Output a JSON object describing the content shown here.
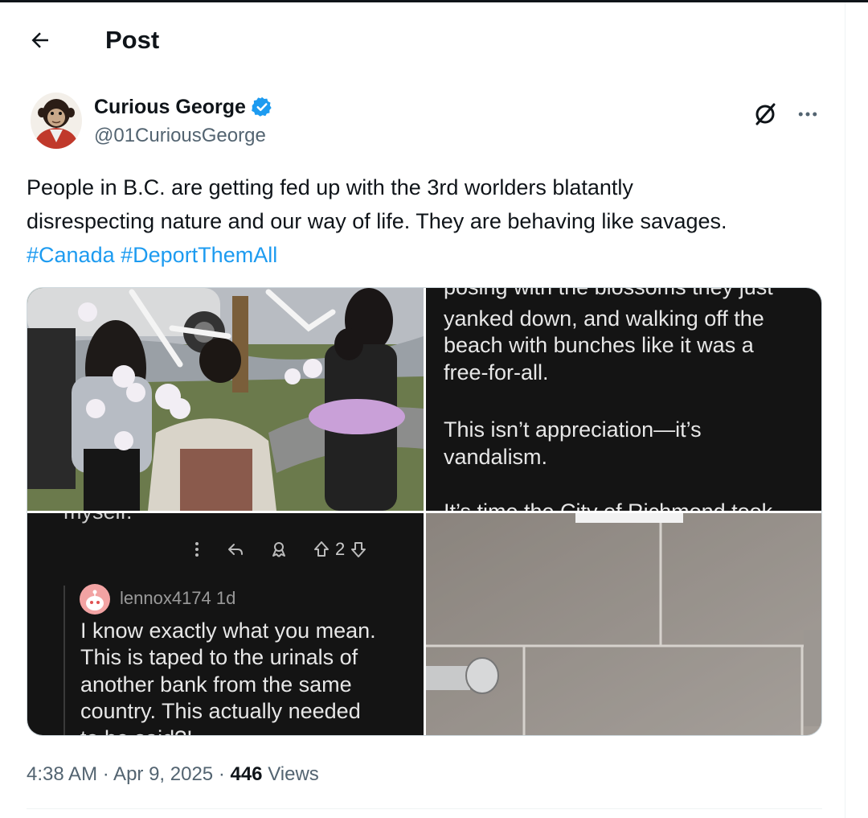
{
  "header": {
    "title": "Post"
  },
  "post": {
    "author": {
      "name": "Curious George",
      "handle": "@01CuriousGeorge"
    },
    "text_line_1": "People in B.C. are getting fed up with the 3rd worlders blatantly",
    "text_line_2": "disrespecting nature and our way of life.  They are behaving like savages.",
    "hashtags": [
      "#Canada",
      "#DeportThemAll"
    ],
    "timestamp": "4:38 AM · Apr 9, 2025",
    "separator": " · ",
    "views_count": "446",
    "views_label": " Views"
  },
  "media": {
    "tile_2": {
      "line_cut_top": "posing with the blossoms they just",
      "line_1": "yanked down, and walking off the",
      "line_2": "beach with bunches like it was a",
      "line_3": "free-for-all.",
      "line_4": "This isn’t appreciation—it’s",
      "line_5": "vandalism.",
      "line_cut_bottom": "It’s time the City of Richmond took"
    },
    "tile_3": {
      "line_cut_top": "myself.",
      "vote_count": "2",
      "reply_user": "lennox4174",
      "reply_age": "1d",
      "reply_line_1": "I know exactly what you mean.",
      "reply_line_2": "This is taped to the urinals of",
      "reply_line_3": "another bank from the same",
      "reply_line_4": "country. This actually needed",
      "reply_line_cut": "to be said?!"
    }
  },
  "colors": {
    "accent": "#1d9bf0",
    "text": "#0f1419",
    "muted": "#536471",
    "verified": "#1d9bf0"
  }
}
